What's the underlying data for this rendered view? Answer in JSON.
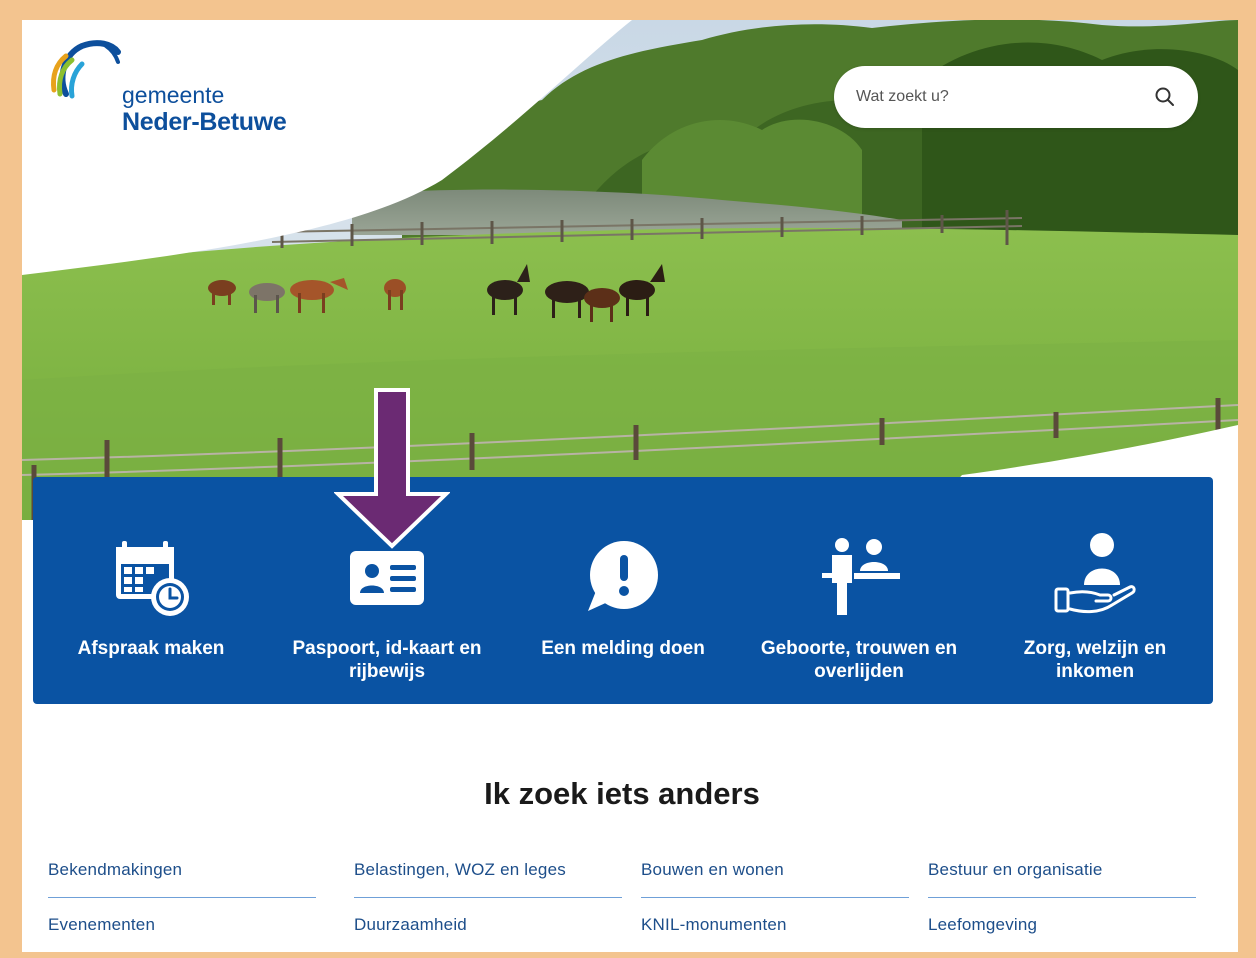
{
  "header": {
    "logo_line1": "gemeente",
    "logo_line2": "Neder-Betuwe"
  },
  "search": {
    "placeholder": "Wat zoekt u?"
  },
  "tiles": [
    {
      "label": "Afspraak maken",
      "icon": "calendar-clock-icon"
    },
    {
      "label": "Paspoort, id-kaart en rijbewijs",
      "icon": "id-card-icon"
    },
    {
      "label": "Een melding doen",
      "icon": "speech-exclamation-icon"
    },
    {
      "label": "Geboorte, trouwen en overlijden",
      "icon": "counter-people-icon"
    },
    {
      "label": "Zorg, welzijn en inkomen",
      "icon": "care-hand-icon"
    }
  ],
  "annotation": {
    "icon": "down-arrow-icon",
    "color": "#6b2a73"
  },
  "section": {
    "title": "Ik zoek iets anders",
    "links": [
      "Bekendmakingen",
      "Belastingen, WOZ en leges",
      "Bouwen en wonen",
      "Bestuur en organisatie",
      "Evenementen",
      "Duurzaamheid",
      "KNIL-monumenten",
      "Leefomgeving"
    ]
  },
  "colors": {
    "brand_blue": "#0a53a3",
    "frame": "#f3c48f",
    "link_text": "#1d4e8a"
  }
}
